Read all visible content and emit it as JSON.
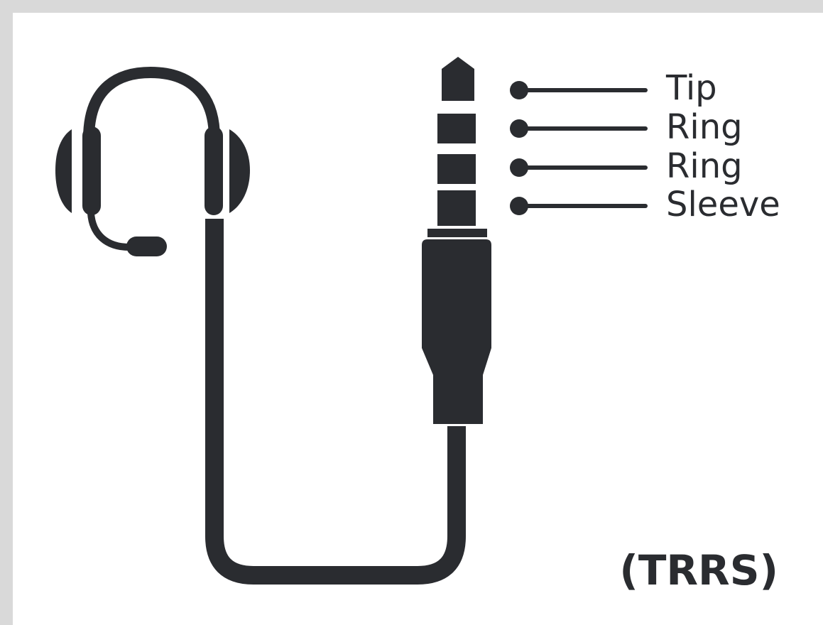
{
  "diagram": {
    "connector_labels": [
      "Tip",
      "Ring",
      "Ring",
      "Sleeve"
    ],
    "type_label": "(TRRS)",
    "icons": [
      "headset-icon",
      "audio-jack-icon",
      "cable-icon"
    ],
    "colors": {
      "ink": "#2a2c30",
      "background": "#ffffff",
      "border": "#d9d9d9"
    }
  }
}
